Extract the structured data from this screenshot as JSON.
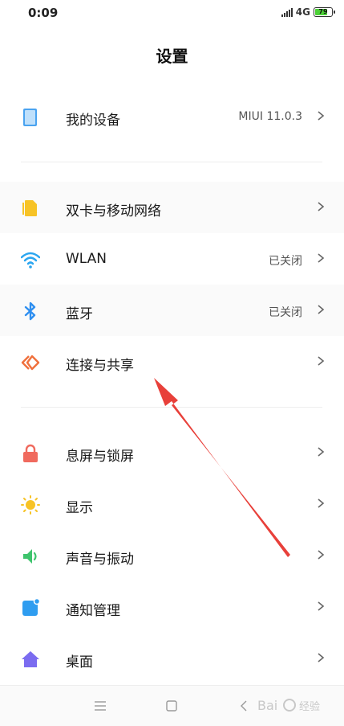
{
  "status": {
    "time": "0:09",
    "network": "4G",
    "battery": "79",
    "battery_level": 0.79
  },
  "header": {
    "title": "设置"
  },
  "items": [
    {
      "label": "我的设备",
      "value": "MIUI 11.0.3",
      "icon": "tablet-icon",
      "color": "#4aa3f0"
    },
    {
      "label": "双卡与移动网络",
      "value": "",
      "icon": "sim-card-icon",
      "color": "#f7c326"
    },
    {
      "label": "WLAN",
      "value": "已关闭",
      "icon": "wifi-icon",
      "color": "#2ba6f0"
    },
    {
      "label": "蓝牙",
      "value": "已关闭",
      "icon": "bluetooth-icon",
      "color": "#2f8ff0"
    },
    {
      "label": "连接与共享",
      "value": "",
      "icon": "share-icon",
      "color": "#f0703c"
    },
    {
      "label": "息屏与锁屏",
      "value": "",
      "icon": "lock-icon",
      "color": "#f06a5e"
    },
    {
      "label": "显示",
      "value": "",
      "icon": "sun-icon",
      "color": "#f7c326"
    },
    {
      "label": "声音与振动",
      "value": "",
      "icon": "speaker-icon",
      "color": "#3ec46d"
    },
    {
      "label": "通知管理",
      "value": "",
      "icon": "notification-icon",
      "color": "#2f9df0"
    },
    {
      "label": "桌面",
      "value": "",
      "icon": "home-icon",
      "color": "#7b6cf0"
    }
  ],
  "annotation": {
    "arrow_color": "#e8403a"
  }
}
